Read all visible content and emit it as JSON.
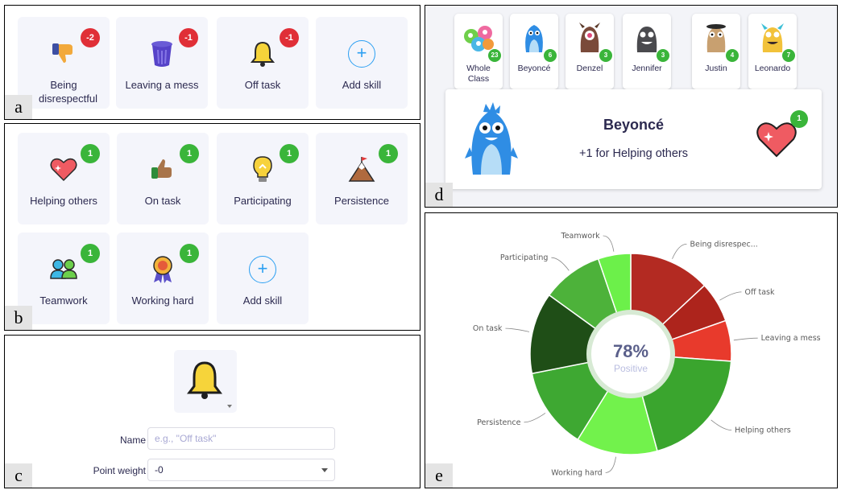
{
  "panels": {
    "a": "a",
    "b": "b",
    "c": "c",
    "d": "d",
    "e": "e"
  },
  "negative_skills": [
    {
      "label": "Being disrespectful",
      "badge": "-2",
      "icon": "thumbs-down-icon"
    },
    {
      "label": "Leaving a mess",
      "badge": "-1",
      "icon": "trash-can-icon"
    },
    {
      "label": "Off task",
      "badge": "-1",
      "icon": "bell-icon"
    },
    {
      "label": "Add skill",
      "icon": "plus-icon"
    }
  ],
  "positive_skills": [
    {
      "label": "Helping others",
      "badge": "1",
      "icon": "heart-icon"
    },
    {
      "label": "On task",
      "badge": "1",
      "icon": "thumbs-up-icon"
    },
    {
      "label": "Participating",
      "badge": "1",
      "icon": "lightbulb-icon"
    },
    {
      "label": "Persistence",
      "badge": "1",
      "icon": "mountain-flag-icon"
    },
    {
      "label": "Teamwork",
      "badge": "1",
      "icon": "teamwork-icon"
    },
    {
      "label": "Working hard",
      "badge": "1",
      "icon": "medal-icon"
    },
    {
      "label": "Add skill",
      "icon": "plus-icon"
    }
  ],
  "editor": {
    "icon": "bell-icon",
    "name_label": "Name",
    "name_placeholder": "e.g., \"Off task\"",
    "weight_label": "Point weight",
    "weight_value": "-0"
  },
  "students": [
    {
      "name": "Whole Class",
      "count": "23"
    },
    {
      "name": "Beyoncé",
      "count": "6"
    },
    {
      "name": "Denzel",
      "count": "3"
    },
    {
      "name": "Jennifer",
      "count": "3"
    },
    {
      "name": "Justin",
      "count": "4"
    },
    {
      "name": "Leonardo",
      "count": "7"
    }
  ],
  "feedback": {
    "student": "Beyoncé",
    "message": "+1 for Helping others",
    "badge": "1",
    "icon": "heart-icon"
  },
  "colors": {
    "negative_badge": "#e02f37",
    "positive_badge": "#3ab53a",
    "accent_blue": "#2b9ff2",
    "text": "#2c2a50"
  },
  "chart_data": {
    "type": "pie",
    "center_value": "78%",
    "center_label": "Positive",
    "slices": [
      {
        "label": "Being disrespec...",
        "value": 2,
        "color": "#b32a22"
      },
      {
        "label": "Off task",
        "value": 1,
        "color": "#ad241c"
      },
      {
        "label": "Leaving a mess",
        "value": 1,
        "color": "#e83a2c"
      },
      {
        "label": "Helping others",
        "value": 3,
        "color": "#3aa52e"
      },
      {
        "label": "Working hard",
        "value": 2,
        "color": "#72f24c"
      },
      {
        "label": "Persistence",
        "value": 2,
        "color": "#3ea832"
      },
      {
        "label": "On task",
        "value": 2,
        "color": "#1f4e17"
      },
      {
        "label": "Participating",
        "value": 1.5,
        "color": "#4db23a"
      },
      {
        "label": "Teamwork",
        "value": 0.8,
        "color": "#6cf04a"
      }
    ]
  }
}
